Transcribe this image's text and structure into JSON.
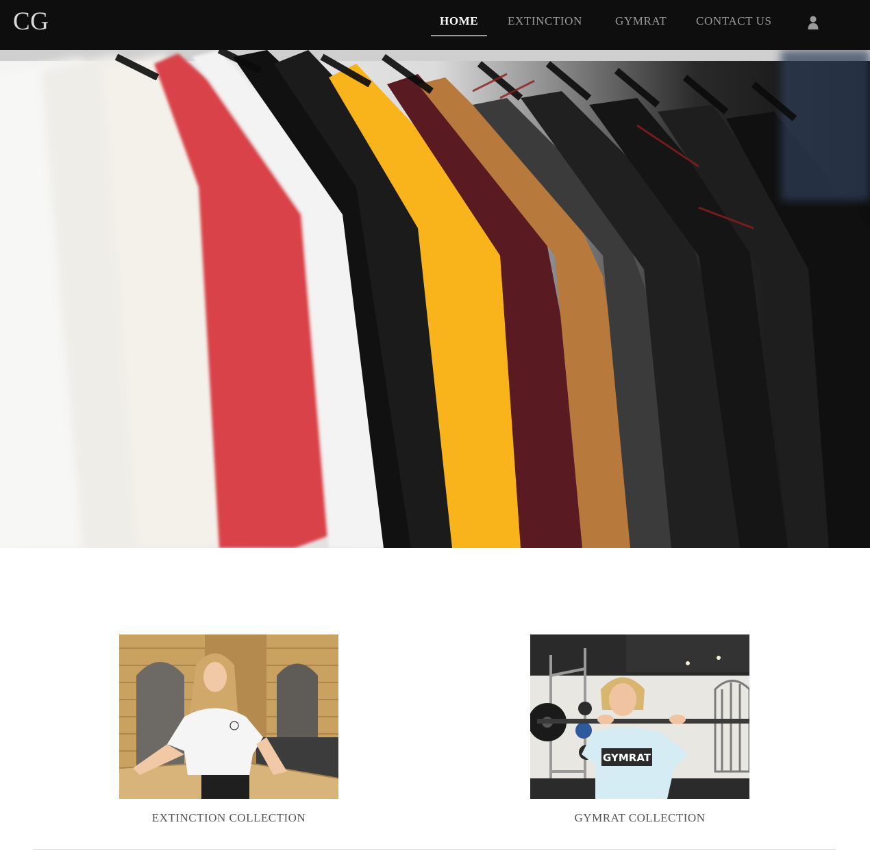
{
  "brand": {
    "logo": "CG"
  },
  "nav": {
    "items": [
      {
        "label": "HOME",
        "active": true
      },
      {
        "label": "EXTINCTION",
        "active": false
      },
      {
        "label": "GYMRAT",
        "active": false
      },
      {
        "label": "CONTACT US",
        "active": false
      }
    ],
    "user_icon": "user-icon"
  },
  "hero": {
    "image": "rack of colorful t-shirts on hangers"
  },
  "collections": [
    {
      "caption": "EXTINCTION COLLECTION",
      "shirt_print": ""
    },
    {
      "caption": "GYMRAT COLLECTION",
      "shirt_print": "GYMRAT"
    }
  ],
  "colors": {
    "header_bg": "#0e0e0e",
    "nav_active": "#ffffff",
    "nav_inactive": "#9a9a9a",
    "caption": "#555555"
  }
}
